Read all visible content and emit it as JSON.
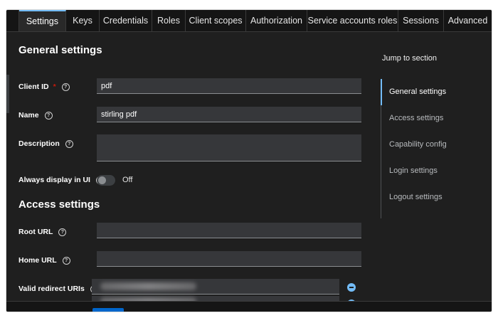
{
  "tabs": [
    {
      "label": "Settings",
      "active": true
    },
    {
      "label": "Keys"
    },
    {
      "label": "Credentials"
    },
    {
      "label": "Roles"
    },
    {
      "label": "Client scopes"
    },
    {
      "label": "Authorization"
    },
    {
      "label": "Service accounts roles"
    },
    {
      "label": "Sessions"
    },
    {
      "label": "Advanced"
    }
  ],
  "general": {
    "heading": "General settings",
    "client_id": {
      "label": "Client ID",
      "required_mark": "*",
      "value": "pdf"
    },
    "name": {
      "label": "Name",
      "value": "stirling pdf"
    },
    "description": {
      "label": "Description",
      "value": ""
    },
    "always_display": {
      "label": "Always display in UI",
      "state_label": "Off",
      "on": false
    }
  },
  "access": {
    "heading": "Access settings",
    "root_url": {
      "label": "Root URL",
      "value": ""
    },
    "home_url": {
      "label": "Home URL",
      "value": ""
    },
    "valid_redirect": {
      "label": "Valid redirect URIs"
    }
  },
  "help_glyph": "?",
  "jump": {
    "title": "Jump to section",
    "items": [
      "General settings",
      "Access settings",
      "Capability config",
      "Login settings",
      "Logout settings"
    ],
    "active_index": 0
  },
  "colors": {
    "accent": "#73bcf7",
    "background": "#1f1f1f",
    "required": "#c9190b"
  }
}
